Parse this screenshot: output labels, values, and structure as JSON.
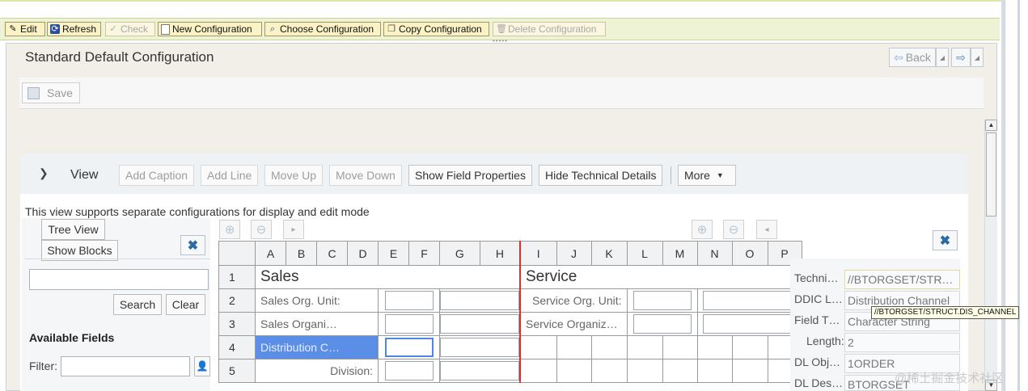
{
  "toolbar": {
    "items": [
      {
        "label": "Edit",
        "icon": "pencil-icon",
        "enabled": true
      },
      {
        "label": "Refresh",
        "icon": "refresh-icon",
        "enabled": true
      },
      {
        "label": "Check",
        "icon": "check-icon",
        "enabled": false
      },
      {
        "label": "New Configuration",
        "icon": "document-icon",
        "enabled": true
      },
      {
        "label": "Choose Configuration",
        "icon": "choose-icon",
        "enabled": true
      },
      {
        "label": "Copy Configuration",
        "icon": "copy-icon",
        "enabled": true
      },
      {
        "label": "Delete Configuration",
        "icon": "trash-icon",
        "enabled": false
      }
    ]
  },
  "page": {
    "title": "Standard Default Configuration",
    "back_label": "Back",
    "save_label": "Save"
  },
  "view": {
    "label": "View",
    "buttons": {
      "add_caption": "Add Caption",
      "add_line": "Add Line",
      "move_up": "Move Up",
      "move_down": "Move Down",
      "show_field_properties": "Show Field Properties",
      "hide_technical_details": "Hide Technical Details",
      "more": "More"
    },
    "note": "This view supports separate configurations for display and edit mode"
  },
  "left_panel": {
    "tree_view": "Tree View",
    "show_blocks": "Show Blocks",
    "search": "Search",
    "clear": "Clear",
    "search_value": "",
    "available_fields": "Available Fields",
    "filter_label": "Filter:",
    "filter_value": ""
  },
  "grid": {
    "columns": [
      "A",
      "B",
      "C",
      "D",
      "E",
      "F",
      "G",
      "H",
      "I",
      "J",
      "K",
      "L",
      "M",
      "N",
      "O",
      "P"
    ],
    "rows": [
      {
        "num": "1",
        "left_section": "Sales",
        "right_section": "Service"
      },
      {
        "num": "2",
        "left_label": "Sales Org. Unit:",
        "right_label": "Service Org. Unit:"
      },
      {
        "num": "3",
        "left_label": "Sales Organi…",
        "right_label": "Service Organiz…"
      },
      {
        "num": "4",
        "left_label": "Distribution C…"
      },
      {
        "num": "5",
        "left_label": "Division:"
      }
    ]
  },
  "properties": {
    "rows": [
      {
        "label": "Techni…",
        "value": "//BTORGSET/STR…"
      },
      {
        "label": "DDIC L…",
        "value": "Distribution Channel"
      },
      {
        "label": "Field T…",
        "value": "Character String"
      },
      {
        "label": "Length:",
        "value": "2"
      },
      {
        "label": "DL Obj…",
        "value": "1ORDER"
      },
      {
        "label": "DL Des…",
        "value": "BTORGSET"
      }
    ],
    "tooltip": "//BTORGSET/STRUCT.DIS_CHANNEL"
  },
  "watermark": "@稀土掘金技术社区",
  "colors": {
    "toolbar_bg": "#eef3d6",
    "selected_cell": "#5b8ee6",
    "section_divider": "#d43030"
  }
}
